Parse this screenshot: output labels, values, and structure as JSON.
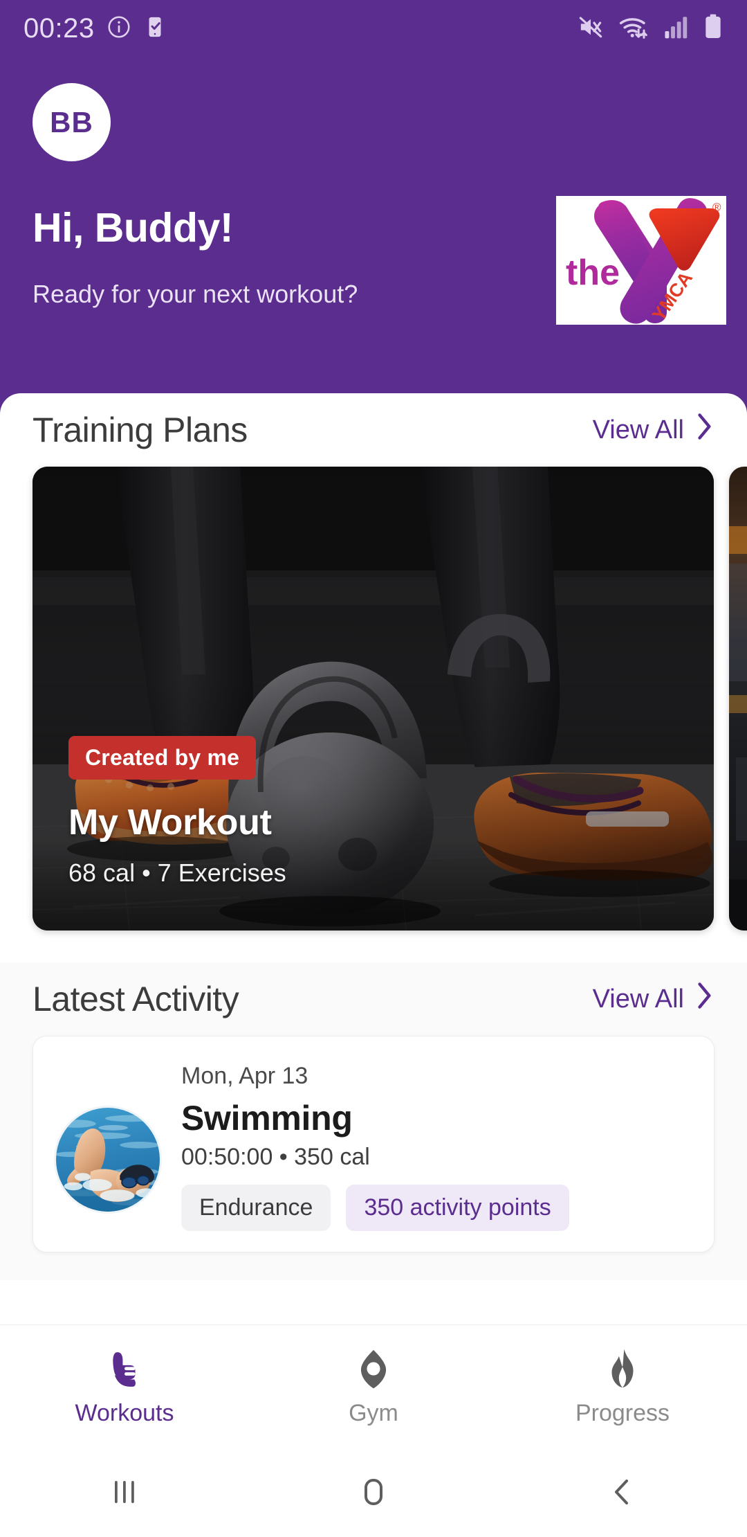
{
  "status_bar": {
    "clock": "00:23",
    "left_icons": [
      "info-circle-icon",
      "phone-check-icon"
    ],
    "right_icons": [
      "mute-icon",
      "wifi-icon",
      "signal-icon",
      "battery-icon"
    ]
  },
  "header": {
    "avatar_initials": "BB",
    "greeting": "Hi, Buddy!",
    "subgreeting": "Ready for your next workout?",
    "logo": {
      "name": "ymca-logo",
      "word_the": "the",
      "word_ymca": "YMCA",
      "registered_mark": "®"
    },
    "background_color": "#5A2D8E"
  },
  "training_plans": {
    "title": "Training Plans",
    "view_all": "View All",
    "cards": [
      {
        "badge": "Created by me",
        "title": "My Workout",
        "subtitle": "68 cal • 7 Exercises",
        "image": "kettlebell-feet-photo",
        "badge_color": "#c4302b"
      },
      {
        "badge": "",
        "title": "",
        "subtitle": "",
        "image": "gym-interior-photo",
        "badge_color": ""
      }
    ]
  },
  "latest_activity": {
    "title": "Latest Activity",
    "view_all": "View All",
    "items": [
      {
        "date": "Mon, Apr 13",
        "name": "Swimming",
        "stats": "00:50:00 • 350 cal",
        "thumb": "swimmer-photo",
        "tags": [
          {
            "label": "Endurance",
            "style": "neutral"
          },
          {
            "label": "350 activity points",
            "style": "points"
          }
        ]
      }
    ]
  },
  "bottom_nav": {
    "items": [
      {
        "label": "Workouts",
        "icon": "shoe-icon",
        "active": true
      },
      {
        "label": "Gym",
        "icon": "gym-marker-icon",
        "active": false
      },
      {
        "label": "Progress",
        "icon": "flame-icon",
        "active": false
      }
    ],
    "active_color": "#5A2D8E",
    "inactive_color": "#8b8b8b"
  },
  "android_nav": {
    "buttons": [
      "recents-icon",
      "home-icon",
      "back-icon"
    ]
  }
}
